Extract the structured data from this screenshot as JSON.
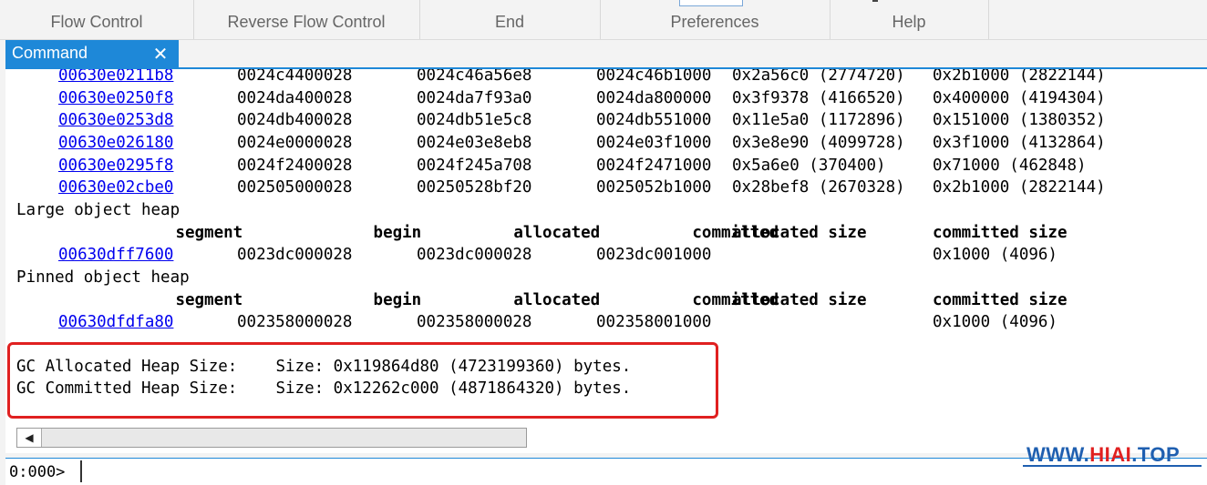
{
  "ribbon": {
    "groups": [
      "Flow Control",
      "Reverse Flow Control",
      "End",
      "Preferences",
      "Help"
    ]
  },
  "pane": {
    "title": "Command",
    "close_glyph": "✕"
  },
  "heap": {
    "cut_row": {
      "segment": "00630e0211b8",
      "begin": "0024c4400028",
      "allocated": "0024c46a56e8",
      "committed": "0024c46b1000",
      "allocated_size": "0x2a56c0 (2774720)",
      "committed_size": "0x2b1000 (2822144)"
    },
    "small_rows": [
      {
        "segment": "00630e0250f8",
        "begin": "0024da400028",
        "allocated": "0024da7f93a0",
        "committed": "0024da800000",
        "allocated_size": "0x3f9378 (4166520)",
        "committed_size": "0x400000 (4194304)"
      },
      {
        "segment": "00630e0253d8",
        "begin": "0024db400028",
        "allocated": "0024db51e5c8",
        "committed": "0024db551000",
        "allocated_size": "0x11e5a0 (1172896)",
        "committed_size": "0x151000 (1380352)"
      },
      {
        "segment": "00630e026180",
        "begin": "0024e0000028",
        "allocated": "0024e03e8eb8",
        "committed": "0024e03f1000",
        "allocated_size": "0x3e8e90 (4099728)",
        "committed_size": "0x3f1000 (4132864)"
      },
      {
        "segment": "00630e0295f8",
        "begin": "0024f2400028",
        "allocated": "0024f245a708",
        "committed": "0024f2471000",
        "allocated_size": "0x5a6e0 (370400)",
        "committed_size": "0x71000 (462848)"
      },
      {
        "segment": "00630e02cbe0",
        "begin": "002505000028",
        "allocated": "00250528bf20",
        "committed": "0025052b1000",
        "allocated_size": "0x28bef8 (2670328)",
        "committed_size": "0x2b1000 (2822144)"
      }
    ],
    "headers": {
      "segment": "segment",
      "begin": "begin",
      "allocated": "allocated",
      "committed": "committed",
      "allocated_size": "allocated size",
      "committed_size": "committed size"
    },
    "loh": {
      "title": "Large object heap",
      "row": {
        "segment": "00630dff7600",
        "begin": "0023dc000028",
        "allocated": "0023dc000028",
        "committed": "0023dc001000",
        "allocated_size": "",
        "committed_size": "0x1000 (4096)"
      }
    },
    "poh": {
      "title": "Pinned object heap",
      "row": {
        "segment": "00630dfdfa80",
        "begin": "002358000028",
        "allocated": "002358000028",
        "committed": "002358001000",
        "allocated_size": "",
        "committed_size": "0x1000 (4096)"
      }
    },
    "separator": "------------------------------",
    "summary": [
      "GC Allocated Heap Size:    Size: 0x119864d80 (4723199360) bytes.",
      "GC Committed Heap Size:    Size: 0x12262c000 (4871864320) bytes."
    ]
  },
  "scrollbar": {
    "left_arrow": "◀"
  },
  "prompt": {
    "label": "0:000>",
    "value": ""
  },
  "watermark": {
    "prefix": "WWW.",
    "highlight": "HIAI",
    "suffix": ".TOP"
  }
}
